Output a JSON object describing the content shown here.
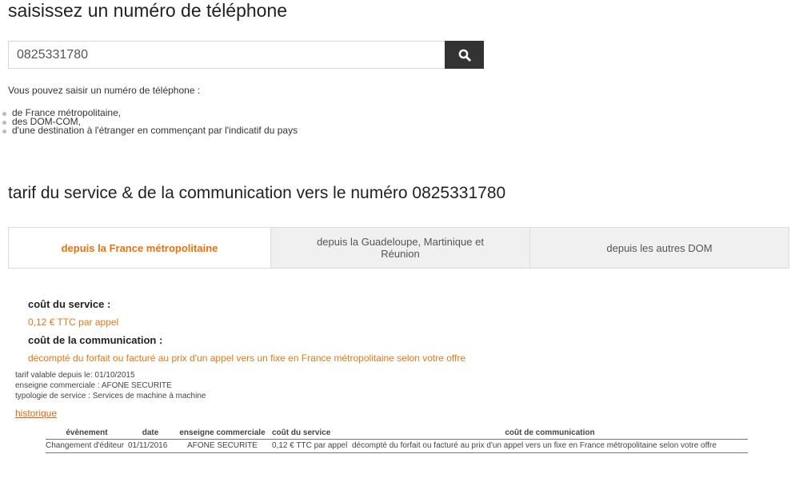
{
  "search": {
    "title": "saisissez un numéro de téléphone",
    "value": "0825331780",
    "button_icon": "search-icon",
    "help_intro": "Vous pouvez saisir un numéro de téléphone :",
    "destinations": [
      "de France métropolitaine,",
      "des DOM-COM,",
      "d'une destination à l'étranger en commençant par l'indicatif du pays"
    ]
  },
  "tariff": {
    "section_title": "tarif du service & de la communication vers le numéro 0825331780",
    "tabs": [
      {
        "label": "depuis la France métropolitaine",
        "active": true
      },
      {
        "label": "depuis la Guadeloupe, Martinique et Réunion",
        "active": false
      },
      {
        "label": "depuis les autres DOM",
        "active": false
      }
    ],
    "service_cost_label": "coût du service :",
    "service_cost_value": "0,12 € TTC par appel",
    "communication_cost_label": "coût de la communication :",
    "communication_cost_value": "décompté du forfait ou facturé au prix d'un appel vers un fixe en France métropolitaine selon votre offre",
    "valid_since": "tarif valable depuis le: 01/10/2015",
    "brand": "enseigne commerciale : AFONE SECURITE",
    "service_type": "typologie de service : Services de machine à machine",
    "history_link": "historique"
  },
  "history": {
    "headers": [
      "évènement",
      "date",
      "enseigne commerciale",
      "coût du service",
      "coût de communication"
    ],
    "rows": [
      [
        "Changement d'éditeur",
        "01/11/2016",
        "AFONE SECURITE",
        "0,12 € TTC par appel",
        "décompté du forfait ou facturé au prix d'un appel vers un fixe en France métropolitaine selon votre offre"
      ]
    ]
  },
  "colors": {
    "accent": "#e8720c",
    "search_button": "#333333"
  }
}
